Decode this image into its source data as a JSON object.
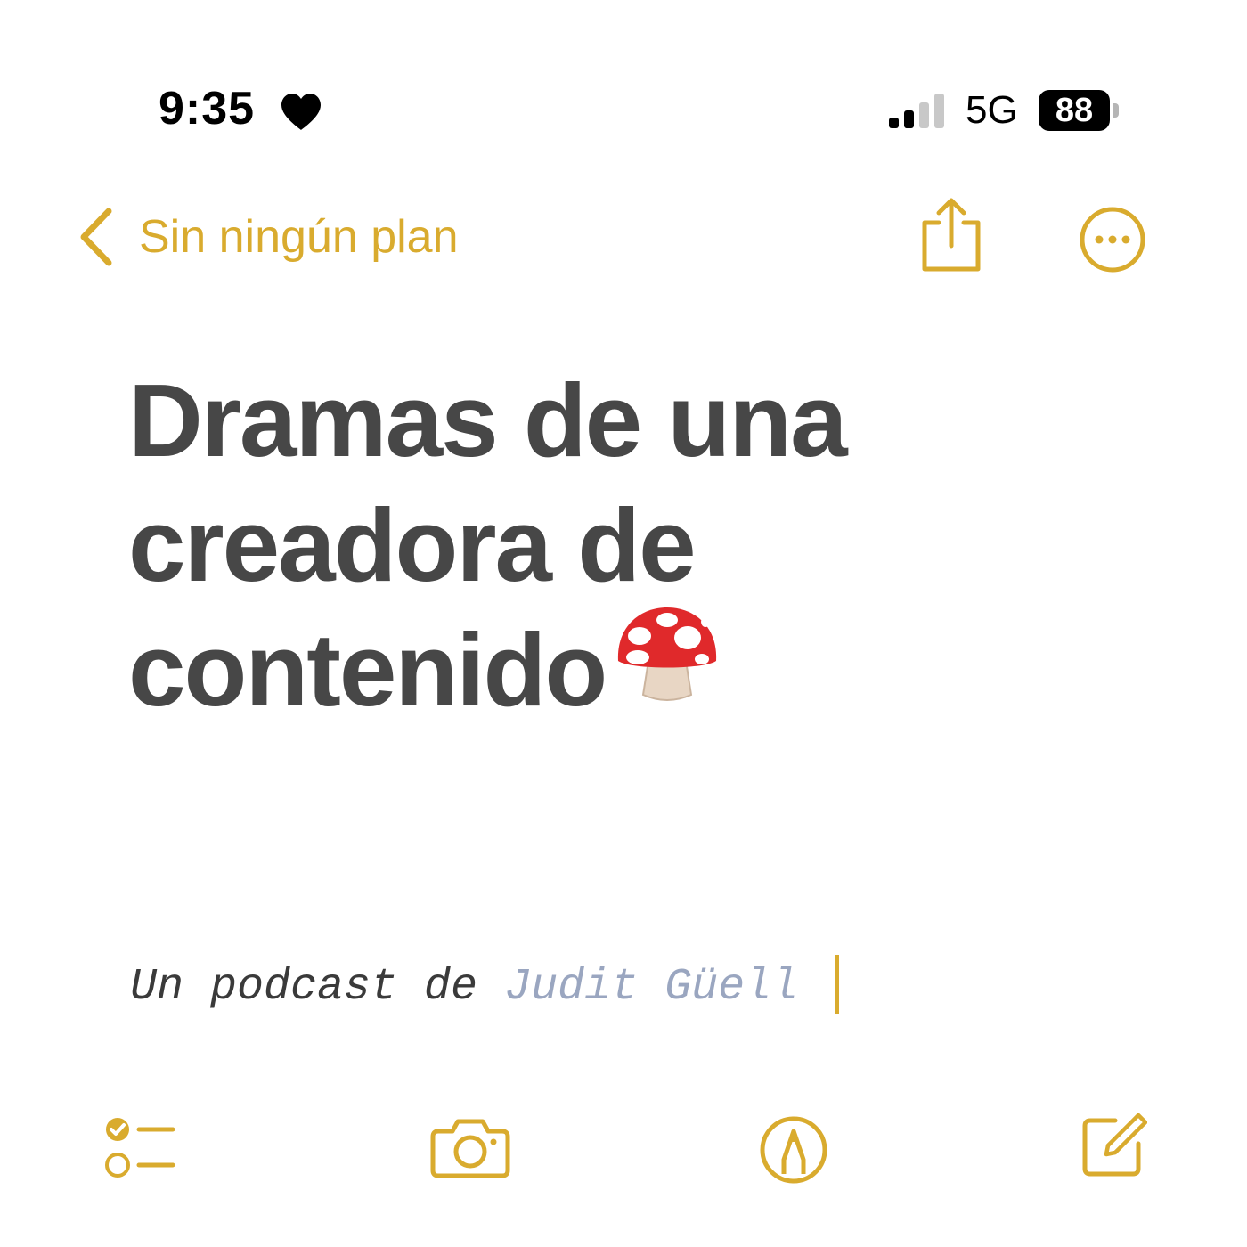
{
  "status_bar": {
    "time": "9:35",
    "focus_icon": "heart-icon",
    "signal_icon": "cellular-signal-icon",
    "network": "5G",
    "battery": "88"
  },
  "nav": {
    "back_label": "Sin ningún plan",
    "back_icon": "chevron-left-icon",
    "share_icon": "share-icon",
    "more_icon": "ellipsis-circle-icon"
  },
  "note": {
    "title": "Dramas de una creadora de contenido",
    "title_emoji": "mushroom-icon",
    "subtitle_prefix": "Un podcast de ",
    "subtitle_author": "Judit Güell"
  },
  "toolbar": {
    "checklist_icon": "checklist-icon",
    "camera_icon": "camera-icon",
    "markup_icon": "markup-pen-icon",
    "compose_icon": "compose-icon"
  },
  "colors": {
    "accent": "#d9ab2e",
    "title_text": "#474747",
    "author_text": "#9aa6c0"
  }
}
